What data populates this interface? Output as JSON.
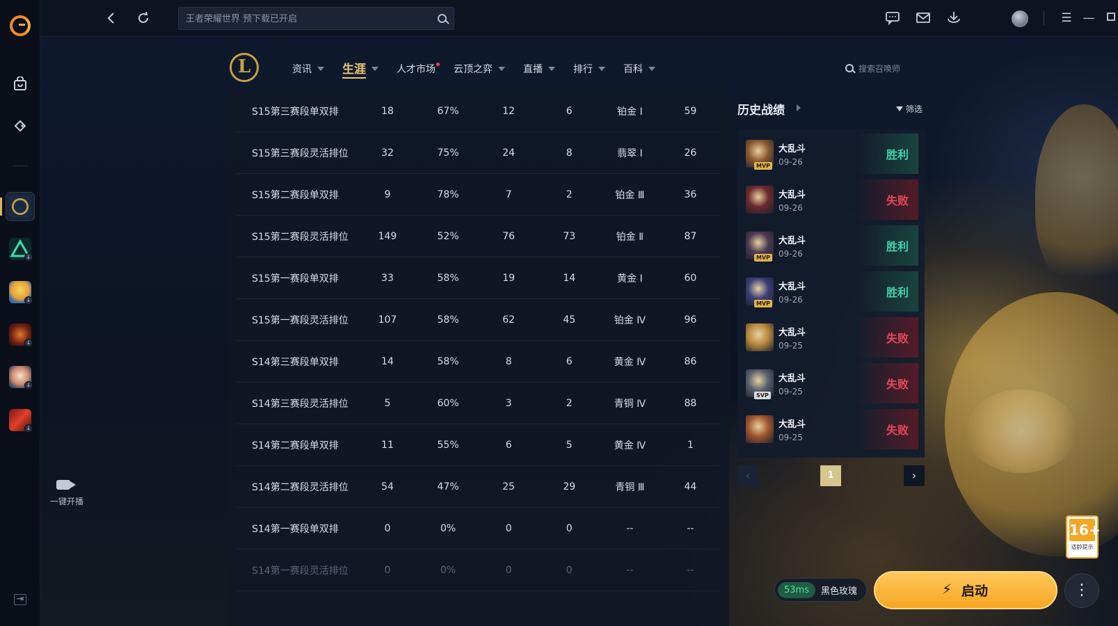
{
  "titlebar": {
    "search_placeholder": "王者荣耀世界 预下载已开启"
  },
  "left_rail": {
    "live_label": "一键开播"
  },
  "game": {
    "logo_letter": "L",
    "tabs": [
      {
        "label": "资讯",
        "caret": true,
        "active": false
      },
      {
        "label": "生涯",
        "caret": true,
        "active": true
      },
      {
        "label": "人才市场",
        "caret": false,
        "active": false,
        "dot": true
      },
      {
        "label": "云顶之弈",
        "caret": true,
        "active": false
      },
      {
        "label": "直播",
        "caret": true,
        "active": false
      },
      {
        "label": "排行",
        "caret": true,
        "active": false
      },
      {
        "label": "百科",
        "caret": true,
        "active": false
      }
    ],
    "summoner_search_placeholder": "搜索召唤师"
  },
  "stats": {
    "rows": [
      {
        "season": "S15第三赛段单双排",
        "games": "18",
        "winrate": "67%",
        "wins": "12",
        "losses": "6",
        "rank": "铂金 Ⅰ",
        "points": "59"
      },
      {
        "season": "S15第三赛段灵活排位",
        "games": "32",
        "winrate": "75%",
        "wins": "24",
        "losses": "8",
        "rank": "翡翠 Ⅰ",
        "points": "26"
      },
      {
        "season": "S15第二赛段单双排",
        "games": "9",
        "winrate": "78%",
        "wins": "7",
        "losses": "2",
        "rank": "铂金 Ⅲ",
        "points": "36"
      },
      {
        "season": "S15第二赛段灵活排位",
        "games": "149",
        "winrate": "52%",
        "wins": "76",
        "losses": "73",
        "rank": "铂金 Ⅱ",
        "points": "87"
      },
      {
        "season": "S15第一赛段单双排",
        "games": "33",
        "winrate": "58%",
        "wins": "19",
        "losses": "14",
        "rank": "黄金 Ⅰ",
        "points": "60"
      },
      {
        "season": "S15第一赛段灵活排位",
        "games": "107",
        "winrate": "58%",
        "wins": "62",
        "losses": "45",
        "rank": "铂金 Ⅳ",
        "points": "96"
      },
      {
        "season": "S14第三赛段单双排",
        "games": "14",
        "winrate": "58%",
        "wins": "8",
        "losses": "6",
        "rank": "黄金 Ⅳ",
        "points": "86"
      },
      {
        "season": "S14第三赛段灵活排位",
        "games": "5",
        "winrate": "60%",
        "wins": "3",
        "losses": "2",
        "rank": "青铜 Ⅳ",
        "points": "88"
      },
      {
        "season": "S14第二赛段单双排",
        "games": "11",
        "winrate": "55%",
        "wins": "6",
        "losses": "5",
        "rank": "黄金 Ⅳ",
        "points": "1"
      },
      {
        "season": "S14第二赛段灵活排位",
        "games": "54",
        "winrate": "47%",
        "wins": "25",
        "losses": "29",
        "rank": "青铜 Ⅲ",
        "points": "44"
      },
      {
        "season": "S14第一赛段单双排",
        "games": "0",
        "winrate": "0%",
        "wins": "0",
        "losses": "0",
        "rank": "--",
        "points": "--"
      },
      {
        "season": "S14第一赛段灵活排位",
        "games": "0",
        "winrate": "0%",
        "wins": "0",
        "losses": "0",
        "rank": "--",
        "points": "--"
      }
    ]
  },
  "history": {
    "title": "历史战绩",
    "filter_label": "筛选",
    "matches": [
      {
        "mode": "大乱斗",
        "date": "09-26",
        "result": "胜利",
        "win": true,
        "tag": "MVP",
        "color": "#8a5a2e"
      },
      {
        "mode": "大乱斗",
        "date": "09-26",
        "result": "失败",
        "win": false,
        "tag": "",
        "color": "#6b2a2e"
      },
      {
        "mode": "大乱斗",
        "date": "09-26",
        "result": "胜利",
        "win": true,
        "tag": "MVP",
        "color": "#4a3a52"
      },
      {
        "mode": "大乱斗",
        "date": "09-26",
        "result": "胜利",
        "win": true,
        "tag": "MVP",
        "color": "#3a3f7a"
      },
      {
        "mode": "大乱斗",
        "date": "09-25",
        "result": "失败",
        "win": false,
        "tag": "",
        "color": "#b9893e"
      },
      {
        "mode": "大乱斗",
        "date": "09-25",
        "result": "失败",
        "win": false,
        "tag": "SVP",
        "color": "#5a5f6e"
      },
      {
        "mode": "大乱斗",
        "date": "09-25",
        "result": "失败",
        "win": false,
        "tag": "",
        "color": "#a0562e"
      }
    ],
    "current_page": "1"
  },
  "footer": {
    "ping": "53ms",
    "server": "黑色玫瑰",
    "launch_label": "启动",
    "age_rating": "16+",
    "age_caption": "适龄提示"
  }
}
